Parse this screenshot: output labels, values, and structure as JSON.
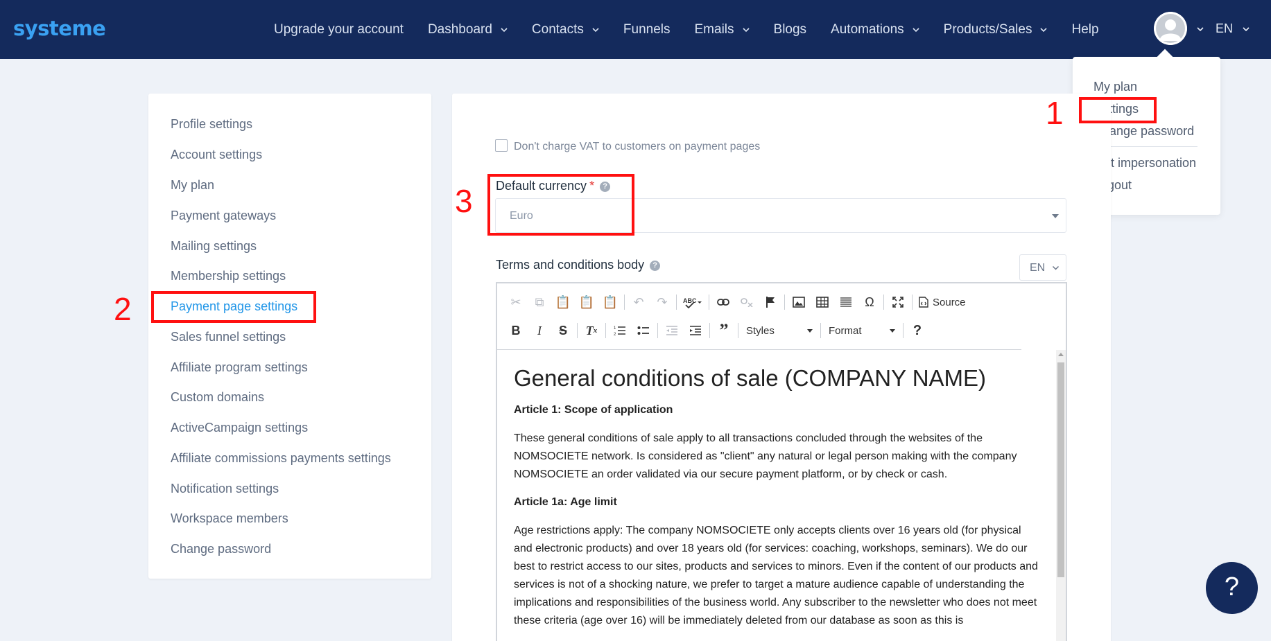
{
  "header": {
    "logo": "systeme",
    "nav": [
      {
        "label": "Upgrade your account",
        "dropdown": false
      },
      {
        "label": "Dashboard",
        "dropdown": true
      },
      {
        "label": "Contacts",
        "dropdown": true
      },
      {
        "label": "Funnels",
        "dropdown": false
      },
      {
        "label": "Emails",
        "dropdown": true
      },
      {
        "label": "Blogs",
        "dropdown": false
      },
      {
        "label": "Automations",
        "dropdown": true
      },
      {
        "label": "Products/Sales",
        "dropdown": true
      },
      {
        "label": "Help",
        "dropdown": false
      }
    ],
    "language": "EN"
  },
  "user_menu": {
    "items": [
      "My plan",
      "Settings",
      "Change password",
      "Exit impersonation",
      "Logout"
    ]
  },
  "sidebar": {
    "items": [
      "Profile settings",
      "Account settings",
      "My plan",
      "Payment gateways",
      "Mailing settings",
      "Membership settings",
      "Payment page settings",
      "Sales funnel settings",
      "Affiliate program settings",
      "Custom domains",
      "ActiveCampaign settings",
      "Affiliate commissions payments settings",
      "Notification settings",
      "Workspace members",
      "Change password"
    ],
    "active": "Payment page settings"
  },
  "form": {
    "vat_label": "Don't charge VAT to customers on payment pages",
    "vat_checked": false,
    "currency_label": "Default currency",
    "required_mark": "*",
    "help_glyph": "?",
    "currency_value": "Euro",
    "terms_label": "Terms and conditions body",
    "terms_language": "EN"
  },
  "editor": {
    "source_label": "Source",
    "styles_label": "Styles",
    "format_label": "Format",
    "title": "General conditions of sale (COMPANY NAME)",
    "article1_heading": "Article 1: Scope of application",
    "article1_body": "These general conditions of sale apply to all transactions concluded through the websites of the NOMSOCIETE network. Is considered as \"client\" any natural or legal person making with the company NOMSOCIETE an order validated via our secure payment platform, or by check or cash.",
    "article1a_heading": "Article 1a: Age limit",
    "article1a_body": "Age restrictions apply: The company NOMSOCIETE only accepts clients over 16 years old (for physical and electronic products) and over 18 years old (for services: coaching, workshops, seminars). We do our best to restrict access to our sites, products and services to minors. Even if the content of our products and services is not of a shocking nature, we prefer to target a mature audience capable of understanding the implications and responsibilities of the business world. Any subscriber to the newsletter who does not meet these criteria (age over 16) will be immediately deleted from our database as soon as this is"
  },
  "annotations": {
    "step1": "1",
    "step2": "2",
    "step3": "3",
    "color": "#ff1010"
  },
  "help_fab": "?",
  "colors": {
    "topbar": "#142a5c",
    "logo": "#3aa1f2",
    "active_link": "#2196e8",
    "background": "#eef2f8"
  }
}
